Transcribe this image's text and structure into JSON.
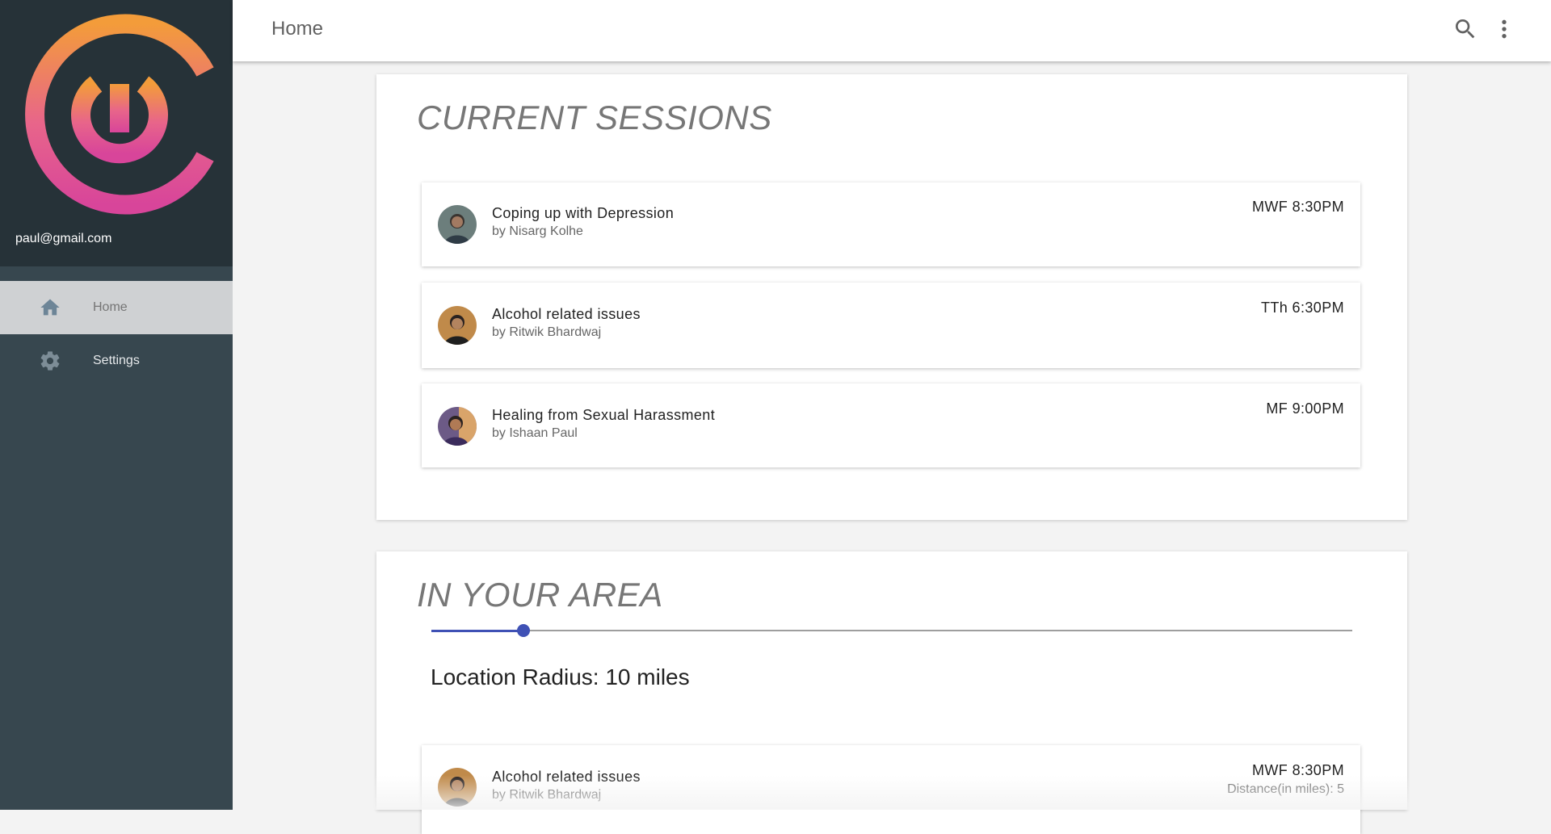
{
  "app": {
    "user_email": "paul@gmail.com",
    "brand_gradient": [
      "#f39c3a",
      "#e84a8a",
      "#c73b9a"
    ]
  },
  "sidebar": {
    "items": [
      {
        "label": "Home",
        "icon": "home-icon",
        "active": true
      },
      {
        "label": "Settings",
        "icon": "gear-icon",
        "active": false
      }
    ]
  },
  "topbar": {
    "title": "Home",
    "icons": [
      "search-icon",
      "more-vert-icon"
    ]
  },
  "current_sessions": {
    "title": "CURRENT SESSIONS",
    "items": [
      {
        "title": "Coping up with Depression",
        "author": "by Nisarg Kolhe",
        "time": "MWF 8:30PM"
      },
      {
        "title": "Alcohol related issues",
        "author": "by Ritwik Bhardwaj",
        "time": "TTh 6:30PM"
      },
      {
        "title": "Healing from Sexual Harassment",
        "author": "by Ishaan Paul",
        "time": "MF 9:00PM"
      }
    ]
  },
  "in_your_area": {
    "title": "IN YOUR AREA",
    "slider_fraction": 0.1,
    "radius_label": "Location Radius: 10 miles",
    "items": [
      {
        "title": "Alcohol related issues",
        "author": "by Ritwik Bhardwaj",
        "time": "MWF 8:30PM",
        "distance": "Distance(in miles): 5"
      }
    ]
  },
  "colors": {
    "accent": "#3f51b5",
    "sidebar_dark": "#263238",
    "sidebar": "#37474f"
  }
}
